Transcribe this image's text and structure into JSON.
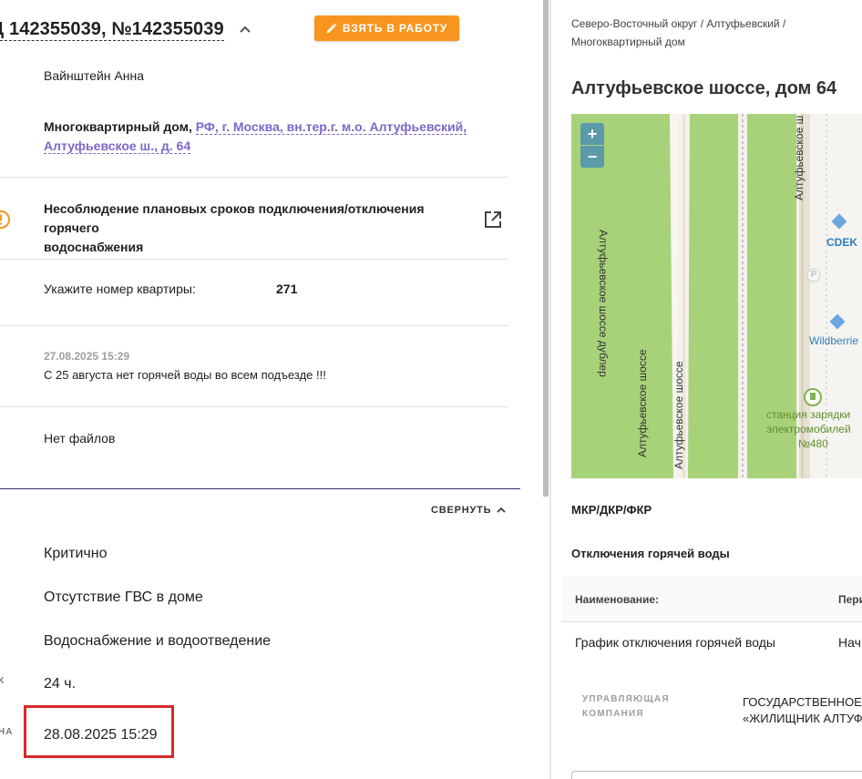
{
  "ticket": {
    "title": "Д 142355039, №142355039",
    "take_button": "ВЗЯТЬ В РАБОТУ",
    "author": "Вайнштейн Анна",
    "address_prefix": "Многоквартирный дом, ",
    "address_link_line1": "РФ, г. Москва, вн.тер.г. м.о. Алтуфьевский,",
    "address_link_line2": "Алтуфьевское ш., д. 64",
    "problem_line1": "Несоблюдение плановых сроков подключения/отключения горячего",
    "problem_line2": "водоснабжения",
    "apartment_label": "Укажите номер квартиры:",
    "apartment_value": "271",
    "comment_date": "27.08.2025 15:29",
    "comment_text": "С 25 августа нет горячей воды во всем подъезде !!!",
    "files": "Нет файлов",
    "collapse_label": "СВЕРНУТЬ",
    "fields": {
      "priority": "Критично",
      "category": "Отсутствие ГВС в доме",
      "topic": "Водоснабжение и водоотведение",
      "deadline": "24 ч.",
      "due_date": "28.08.2025 15:29"
    },
    "frag_label_1": "К",
    "frag_label_2": "НА"
  },
  "right": {
    "breadcrumb_line1": "Северо-Восточный округ / Алтуфьевский /",
    "breadcrumb_line2": "Многоквартирный дом",
    "address_title": "Алтуфьевское шоссе, дом 64",
    "map": {
      "zoom_in": "+",
      "zoom_out": "−",
      "labels": {
        "road_dubler": "Алтуфьевское шоссе дублер",
        "road1": "Алтуфьевское шоссе",
        "road2": "Алтуфьевское шоссе",
        "road_top": "Алтуфьевское ш",
        "cdek": "CDEK",
        "parking": "P",
        "wildberries": "Wildberrie",
        "station_line1": "станция зарядки",
        "station_line2": "электромобилей",
        "station_line3": "№480"
      }
    },
    "section_mkr": "МКР/ДКР/ФКР",
    "section_hot_water": "Отключения горячей воды",
    "table": {
      "col_name": "Наименование:",
      "col_period": "Пери",
      "row_name": "График отключения горячей воды",
      "row_period": "Нач"
    },
    "company_label_line1": "УПРАВЛЯЮЩАЯ",
    "company_label_line2": "КОМПАНИЯ",
    "company_line1": "ГОСУДАРСТВЕННОЕ",
    "company_line2": "«ЖИЛИЩНИК АЛТУФ"
  },
  "colors": {
    "accent_orange": "#f7951e",
    "link_purple": "#7b68c9",
    "highlight_red": "#d62a2a",
    "map_green": "#a8d27a"
  }
}
